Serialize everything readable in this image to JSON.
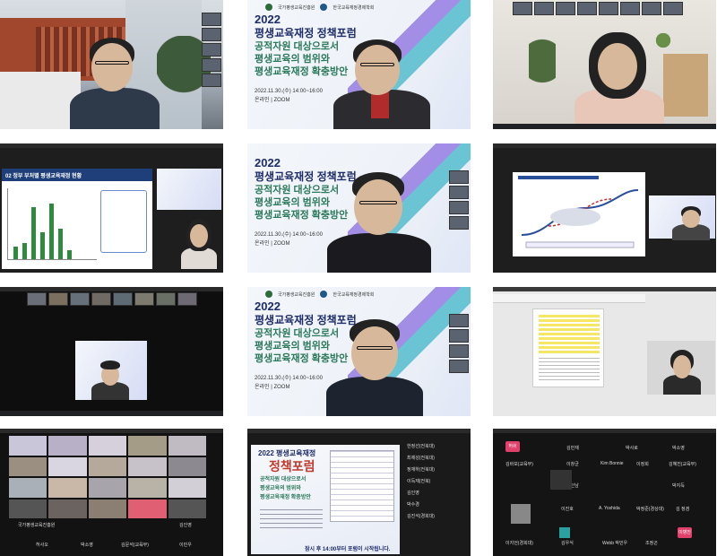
{
  "poster": {
    "year_title": "2022",
    "title": "평생교육재정 정책포럼",
    "sub1": "공적자원 대상으로서",
    "sub2": "평생교육의 범위와",
    "sub3": "평생교육재정 확충방안",
    "date": "2022.11.30.(수) 14:00~16:00",
    "venue": "온라인 | ZOOM",
    "org1": "국가평생교육진흥원",
    "org2": "한국교육재정경제학회"
  },
  "slide_tile3": {
    "heading": "02  정부 부처별 평생교육재정 현황"
  },
  "tile10": {
    "poster_title_a": "2022 평생교육재정",
    "poster_title_b": "정책포럼",
    "sub1": "공적자원 대상으로서",
    "sub2": "평생교육의 범위와",
    "sub3": "평생교육재정 확충방안",
    "notice": "잠시 후 14:00부터 포럼이 시작됩니다.",
    "side_names": [
      "한정선(전북대)",
      "최제성(전북대)",
      "정재하(전북대)",
      "이득재(전북)",
      "김인영",
      "박수경",
      "김진석(경희대)"
    ]
  },
  "tile9_names": [
    "국가평생교육진흥원",
    "허사오",
    "박소영",
    "김문석(교육부)",
    "이민우",
    "김인영"
  ],
  "tile11_names": [
    "김민재",
    "박사로",
    "박소영",
    "김바보(교육부)",
    "이창균",
    "Kim Bonnie",
    "이정희",
    "김혜진(교육부)",
    "한인남",
    "박지득",
    "이진호",
    "A. Yoshida",
    "박정준(경상대)",
    "김 정겸",
    "이지언(경희대)",
    "김우식",
    "Webb 박민우",
    "조정곤"
  ],
  "tile11_badges": [
    "허쉬",
    "이병진"
  ],
  "colors": {
    "poster_navy": "#1d2c6b",
    "poster_green": "#2b7a5a",
    "zoom_dark": "#1c1c1c"
  }
}
